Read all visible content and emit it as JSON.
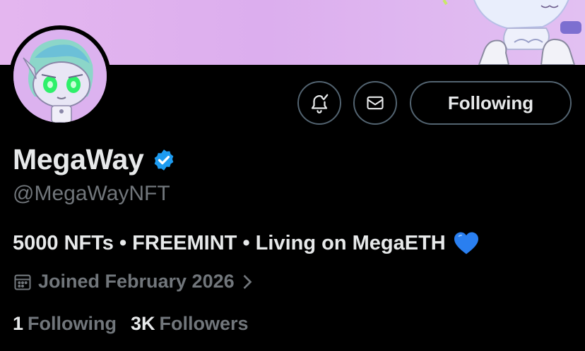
{
  "profile": {
    "display_name": "MegaWay",
    "handle": "@MegaWayNFT",
    "verified": true,
    "bio": "5000 NFTs • FREEMINT • Living on MegaETH",
    "bio_emoji": "blue-heart",
    "joined": "Joined February 2026",
    "following_count": "1",
    "following_label": "Following",
    "followers_count": "3K",
    "followers_label": "Followers"
  },
  "actions": {
    "notify_icon": "bell-plus-icon",
    "message_icon": "envelope-icon",
    "follow_label": "Following"
  },
  "colors": {
    "background": "#000000",
    "text_primary": "#e7e9ea",
    "text_secondary": "#71767b",
    "border": "#536471",
    "verified": "#1d9bf0",
    "banner": "#e0b4f0"
  }
}
